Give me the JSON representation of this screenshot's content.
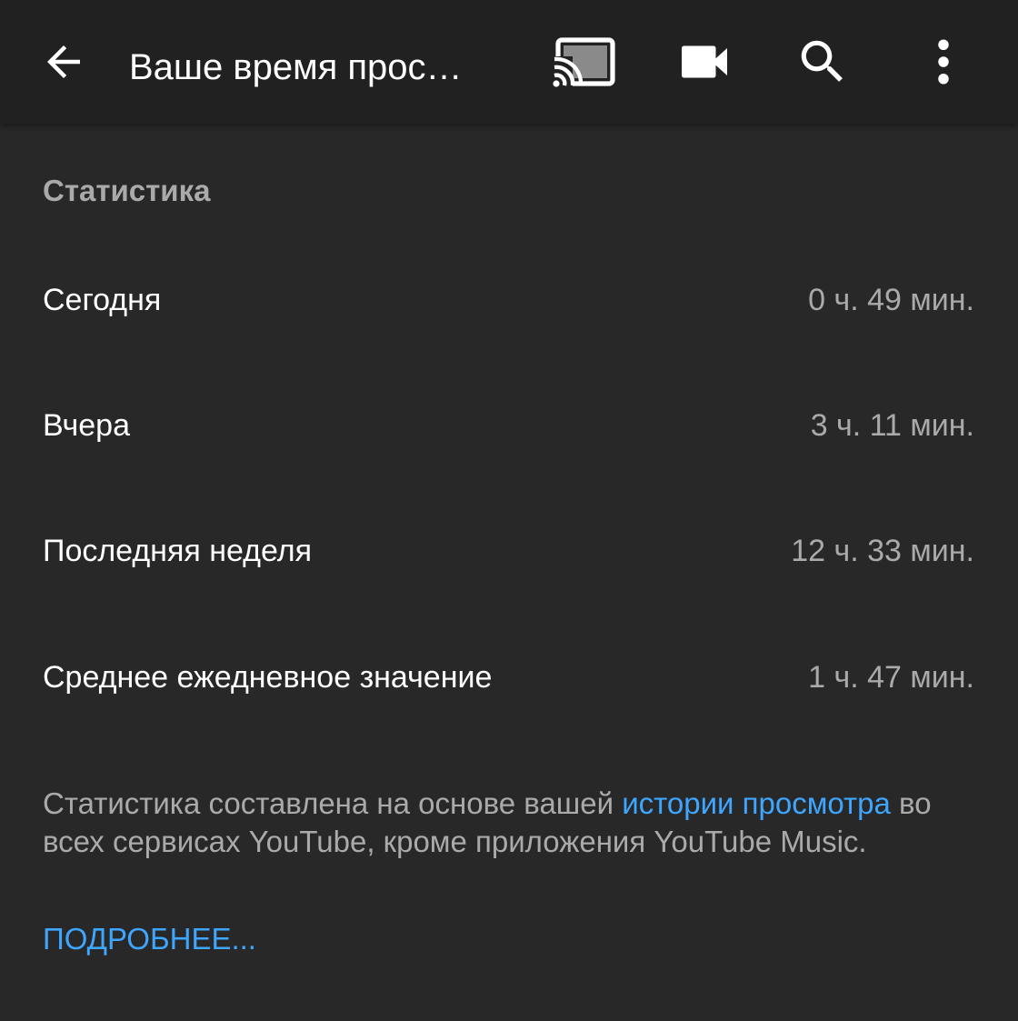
{
  "toolbar": {
    "title": "Ваше время прос…",
    "icons": {
      "back": "arrow-back-icon",
      "cast": "cast-icon",
      "camera": "video-camera-icon",
      "search": "search-icon",
      "more": "more-vert-icon"
    }
  },
  "section": {
    "header": "Статистика"
  },
  "stats": [
    {
      "label": "Сегодня",
      "value": "0 ч. 49 мин."
    },
    {
      "label": "Вчера",
      "value": "3 ч. 11 мин."
    },
    {
      "label": "Последняя неделя",
      "value": "12 ч. 33 мин."
    },
    {
      "label": "Среднее ежедневное значение",
      "value": "1 ч. 47 мин."
    }
  ],
  "footnote": {
    "prefix": "Статистика составлена на основе вашей ",
    "link": "истории просмотра",
    "suffix": " во всех сервисах YouTube, кроме приложения YouTube Music."
  },
  "more_link": "ПОДРОБНЕЕ...",
  "colors": {
    "background": "#282828",
    "toolbar": "#212121",
    "primary_text": "#ffffff",
    "secondary_text": "#aaaaaa",
    "link": "#3ea6ff"
  }
}
